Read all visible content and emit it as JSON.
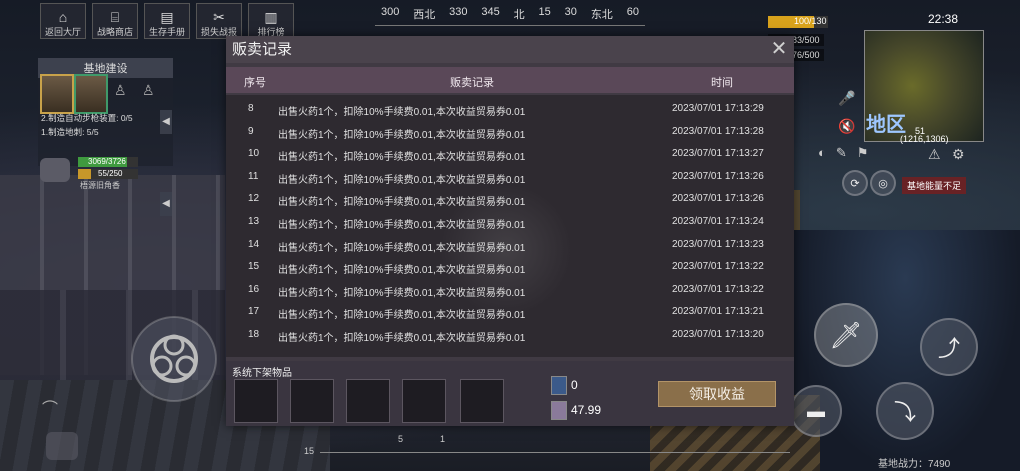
{
  "topnav": {
    "items": [
      {
        "label": "返回大厅",
        "icon": "home-icon",
        "glyph": "⌂"
      },
      {
        "label": "战略商店",
        "icon": "shop-icon",
        "glyph": "⌸"
      },
      {
        "label": "生存手册",
        "icon": "book-icon",
        "glyph": "▤"
      },
      {
        "label": "损失战报",
        "icon": "broken-icon",
        "glyph": "✂"
      },
      {
        "label": "排行榜",
        "icon": "ranking-icon",
        "glyph": "▥"
      }
    ]
  },
  "compass": [
    "300",
    "西北",
    "330",
    "345",
    "北",
    "15",
    "30",
    "东北",
    "60"
  ],
  "hud": {
    "hp_text": "100/130",
    "hp_fraction": 0.77,
    "stat1": "83/500",
    "stat2": "76/500",
    "clock": "22:38",
    "minimap_label": "地区",
    "minimap_num": "51",
    "minimap_coord": "(1216,1306)",
    "warning": "基地能量不足",
    "power": "基地战力：7490",
    "bottom_left": "15",
    "bottom_mid1": "5",
    "bottom_mid2": "1"
  },
  "base": {
    "title": "基地建设",
    "task1": "2.制造自动步枪装置: 0/5",
    "task2": "1.制造地刺: 5/5",
    "xp_text": "3069/3726",
    "xp_fraction": 0.82,
    "energy_text": "55/250",
    "energy_fraction": 0.22,
    "player_name": "梧源旧角香"
  },
  "dialog": {
    "title": "贩卖记录",
    "columns": [
      "序号",
      "贩卖记录",
      "时间"
    ],
    "rows": [
      {
        "id": "8",
        "record": "出售火药1个，扣除10%手续费0.01,本次收益贸易券0.01",
        "time": "2023/07/01 17:13:29"
      },
      {
        "id": "9",
        "record": "出售火药1个，扣除10%手续费0.01,本次收益贸易券0.01",
        "time": "2023/07/01 17:13:28"
      },
      {
        "id": "10",
        "record": "出售火药1个，扣除10%手续费0.01,本次收益贸易券0.01",
        "time": "2023/07/01 17:13:27"
      },
      {
        "id": "11",
        "record": "出售火药1个，扣除10%手续费0.01,本次收益贸易券0.01",
        "time": "2023/07/01 17:13:26"
      },
      {
        "id": "12",
        "record": "出售火药1个，扣除10%手续费0.01,本次收益贸易券0.01",
        "time": "2023/07/01 17:13:26"
      },
      {
        "id": "13",
        "record": "出售火药1个，扣除10%手续费0.01,本次收益贸易券0.01",
        "time": "2023/07/01 17:13:24"
      },
      {
        "id": "14",
        "record": "出售火药1个，扣除10%手续费0.01,本次收益贸易券0.01",
        "time": "2023/07/01 17:13:23"
      },
      {
        "id": "15",
        "record": "出售火药1个，扣除10%手续费0.01,本次收益贸易券0.01",
        "time": "2023/07/01 17:13:22"
      },
      {
        "id": "16",
        "record": "出售火药1个，扣除10%手续费0.01,本次收益贸易券0.01",
        "time": "2023/07/01 17:13:22"
      },
      {
        "id": "17",
        "record": "出售火药1个，扣除10%手续费0.01,本次收益贸易券0.01",
        "time": "2023/07/01 17:13:21"
      },
      {
        "id": "18",
        "record": "出售火药1个，扣除10%手续费0.01,本次收益贸易券0.01",
        "time": "2023/07/01 17:13:20"
      }
    ],
    "offshelf_label": "系统下架物品",
    "currency1_value": "0",
    "currency2_value": "47.99",
    "claim_label": "领取收益"
  }
}
